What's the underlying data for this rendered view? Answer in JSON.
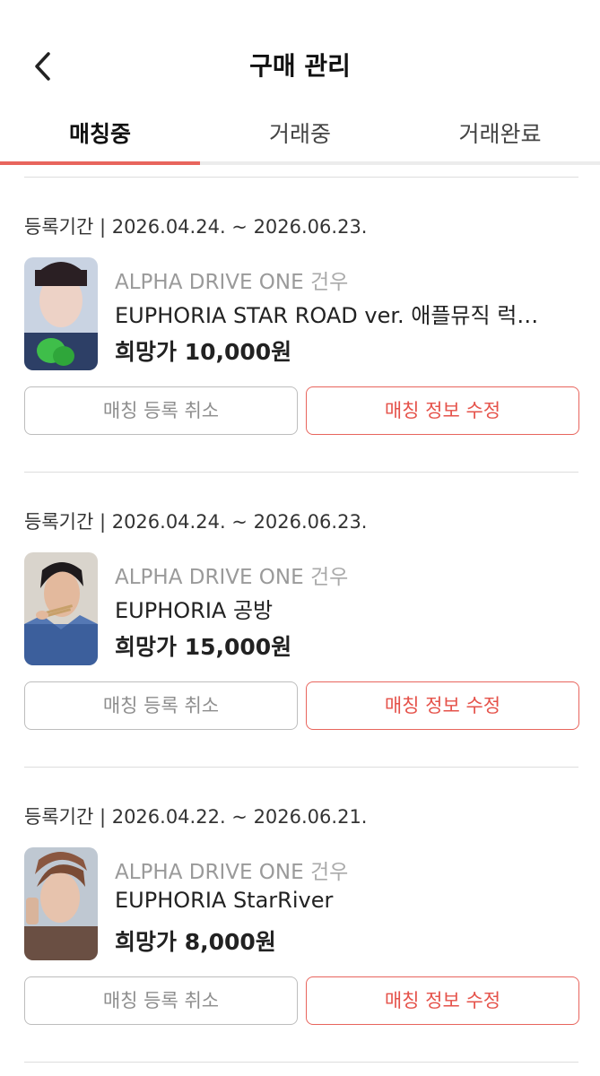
{
  "header": {
    "title": "구매 관리"
  },
  "tabs": [
    {
      "label": "매칭중",
      "active": true
    },
    {
      "label": "거래중",
      "active": false
    },
    {
      "label": "거래완료",
      "active": false
    }
  ],
  "colors": {
    "accent": "#e8655d",
    "muted": "#9a9a9a"
  },
  "listings": [
    {
      "period": "등록기간 | 2026.04.24. ~ 2026.06.23.",
      "artist": "ALPHA DRIVE ONE",
      "member": "건우",
      "item": "EUPHORIA STAR ROAD ver. 애플뮤직 럭…",
      "price": "희망가 10,000원",
      "cancel_label": "매칭 등록 취소",
      "edit_label": "매칭 정보 수정"
    },
    {
      "period": "등록기간 | 2026.04.24. ~ 2026.06.23.",
      "artist": "ALPHA DRIVE ONE",
      "member": "건우",
      "item": "EUPHORIA 공방",
      "price": "희망가 15,000원",
      "cancel_label": "매칭 등록 취소",
      "edit_label": "매칭 정보 수정"
    },
    {
      "period": "등록기간 | 2026.04.22. ~ 2026.06.21.",
      "artist": "ALPHA DRIVE ONE",
      "member": "건우",
      "item": "EUPHORIA StarRiver",
      "price": "희망가 8,000원",
      "cancel_label": "매칭 등록 취소",
      "edit_label": "매칭 정보 수정"
    }
  ]
}
